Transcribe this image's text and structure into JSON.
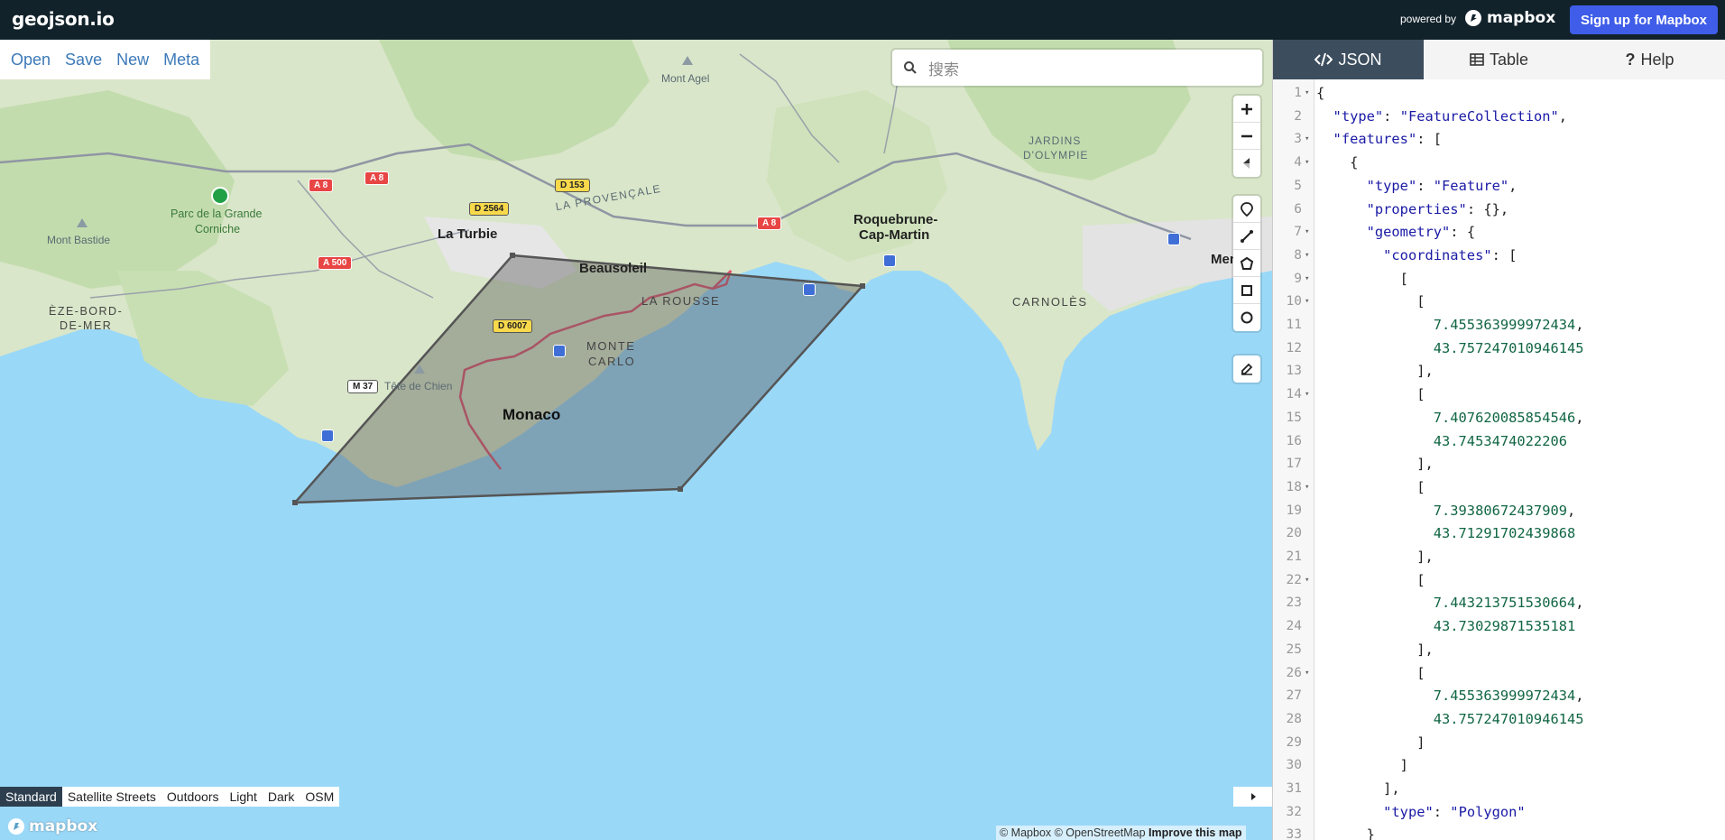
{
  "topbar": {
    "brand": "geojson.io",
    "powered_by": "powered by",
    "mapbox_label": "mapbox",
    "signup_label": "Sign up for Mapbox"
  },
  "file_menu": [
    "Open",
    "Save",
    "New",
    "Meta"
  ],
  "search": {
    "placeholder": "搜索"
  },
  "map_controls": {
    "zoom": [
      "zoom-in-icon",
      "zoom-out-icon",
      "compass-icon"
    ],
    "draw": [
      "marker-icon",
      "line-icon",
      "polygon-icon",
      "rectangle-icon",
      "circle-icon"
    ],
    "edit": [
      "edit-icon"
    ]
  },
  "map_labels": [
    "Mont Agel",
    "JARDINS",
    "D'OLYMPIE",
    "Parc de la Grande",
    "Corniche",
    "Mont Bastide",
    "La Turbie",
    "LA PROVENÇALE",
    "Roquebrune-",
    "Cap-Martin",
    "Beausoleil",
    "LA ROUSSE",
    "ÈZE-BORD-",
    "DE-MER",
    "MONTE",
    "CARLO",
    "Monaco",
    "Tête de Chien",
    "CARNOLÈS",
    "Men"
  ],
  "road_shields": [
    "A 8",
    "A 8",
    "A 8",
    "D 153",
    "D 2564",
    "A 500",
    "D 6007",
    "M 37"
  ],
  "layer_switcher": {
    "options": [
      "Standard",
      "Satellite Streets",
      "Outdoors",
      "Light",
      "Dark",
      "OSM"
    ],
    "active": "Standard"
  },
  "attribution": {
    "text": "© Mapbox © OpenStreetMap",
    "improve": "Improve this map"
  },
  "bottom_logo": "mapbox",
  "tabs": [
    {
      "label": "JSON",
      "icon": "code-icon",
      "active": true
    },
    {
      "label": "Table",
      "icon": "table-icon",
      "active": false
    },
    {
      "label": "Help",
      "icon": "question-icon",
      "active": false
    }
  ],
  "editor": {
    "lines": [
      {
        "n": "1",
        "fold": true,
        "text": "{"
      },
      {
        "n": "2",
        "fold": false,
        "text": "  \"type\": \"FeatureCollection\","
      },
      {
        "n": "3",
        "fold": true,
        "text": "  \"features\": ["
      },
      {
        "n": "4",
        "fold": true,
        "text": "    {"
      },
      {
        "n": "5",
        "fold": false,
        "text": "      \"type\": \"Feature\","
      },
      {
        "n": "6",
        "fold": false,
        "text": "      \"properties\": {},"
      },
      {
        "n": "7",
        "fold": true,
        "text": "      \"geometry\": {"
      },
      {
        "n": "8",
        "fold": true,
        "text": "        \"coordinates\": ["
      },
      {
        "n": "9",
        "fold": true,
        "text": "          ["
      },
      {
        "n": "10",
        "fold": true,
        "text": "            ["
      },
      {
        "n": "11",
        "fold": false,
        "text": "              7.455363999972434,"
      },
      {
        "n": "12",
        "fold": false,
        "text": "              43.757247010946145"
      },
      {
        "n": "13",
        "fold": false,
        "text": "            ],"
      },
      {
        "n": "14",
        "fold": true,
        "text": "            ["
      },
      {
        "n": "15",
        "fold": false,
        "text": "              7.407620085854546,"
      },
      {
        "n": "16",
        "fold": false,
        "text": "              43.7453474022206"
      },
      {
        "n": "17",
        "fold": false,
        "text": "            ],"
      },
      {
        "n": "18",
        "fold": true,
        "text": "            ["
      },
      {
        "n": "19",
        "fold": false,
        "text": "              7.39380672437909,"
      },
      {
        "n": "20",
        "fold": false,
        "text": "              43.71291702439868"
      },
      {
        "n": "21",
        "fold": false,
        "text": "            ],"
      },
      {
        "n": "22",
        "fold": true,
        "text": "            ["
      },
      {
        "n": "23",
        "fold": false,
        "text": "              7.443213751530664,"
      },
      {
        "n": "24",
        "fold": false,
        "text": "              43.73029871535181"
      },
      {
        "n": "25",
        "fold": false,
        "text": "            ],"
      },
      {
        "n": "26",
        "fold": true,
        "text": "            ["
      },
      {
        "n": "27",
        "fold": false,
        "text": "              7.455363999972434,"
      },
      {
        "n": "28",
        "fold": false,
        "text": "              43.757247010946145"
      },
      {
        "n": "29",
        "fold": false,
        "text": "            ]"
      },
      {
        "n": "30",
        "fold": false,
        "text": "          ]"
      },
      {
        "n": "31",
        "fold": false,
        "text": "        ],"
      },
      {
        "n": "32",
        "fold": false,
        "text": "        \"type\": \"Polygon\""
      },
      {
        "n": "33",
        "fold": false,
        "text": "      }"
      }
    ]
  },
  "colors": {
    "topbar": "#12222b",
    "signup": "#3f5de8",
    "link": "#3c79b8",
    "water": "#9ad8f8",
    "land": "#d9e6c9",
    "polygon_fill": "#555555",
    "tab_active": "#3c4e5e"
  }
}
